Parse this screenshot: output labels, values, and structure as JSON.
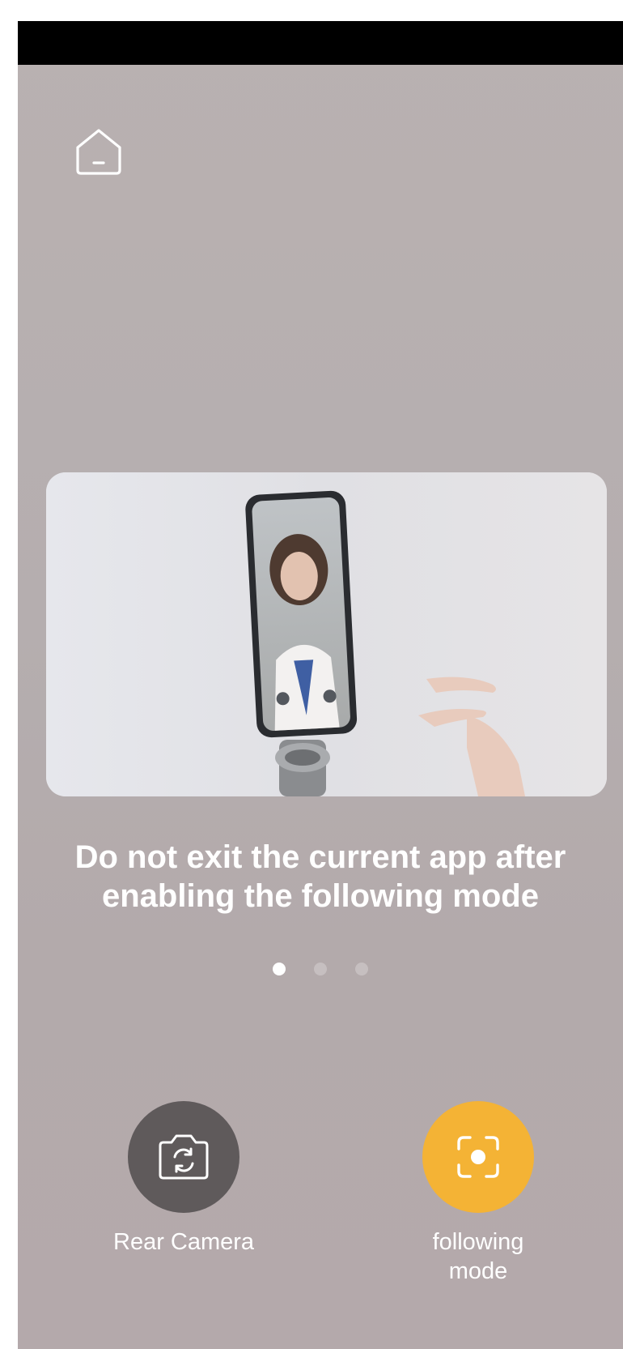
{
  "title_line1": "Do not exit the current app after",
  "title_line2": "enabling the following mode",
  "carousel": {
    "total": 3,
    "active_index": 0
  },
  "actions": {
    "rear_camera_label": "Rear Camera",
    "following_mode_line1": "following",
    "following_mode_line2": "mode"
  },
  "icons": {
    "home": "home-icon",
    "rear_camera": "camera-switch-icon",
    "following_mode": "focus-target-icon"
  },
  "colors": {
    "following_accent": "#f4b335",
    "rear_camera_button": "#5f5a5b",
    "status_bar": "#000000"
  }
}
